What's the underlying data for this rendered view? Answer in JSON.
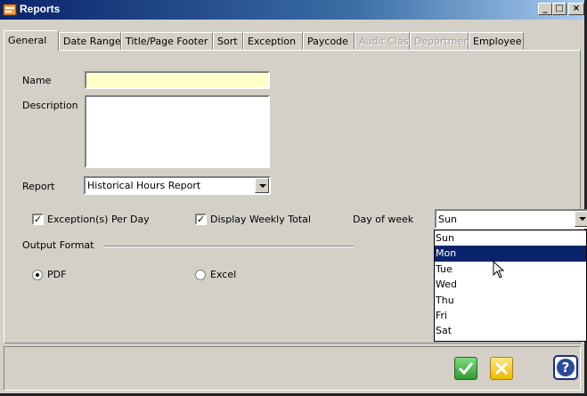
{
  "window": {
    "title": "Reports"
  },
  "tabs": [
    {
      "label": "General",
      "selected": true,
      "enabled": true
    },
    {
      "label": "Date Range",
      "enabled": true
    },
    {
      "label": "Title/Page Footer",
      "enabled": true
    },
    {
      "label": "Sort",
      "enabled": true
    },
    {
      "label": "Exception",
      "enabled": true
    },
    {
      "label": "Paycode",
      "enabled": true
    },
    {
      "label": "Audit Class",
      "enabled": false
    },
    {
      "label": "Department",
      "enabled": false
    },
    {
      "label": "Employee",
      "enabled": true
    }
  ],
  "form": {
    "name_label": "Name",
    "name_value": "",
    "description_label": "Description",
    "description_value": "",
    "report_label": "Report",
    "report_value": "Historical Hours Report",
    "exceptions_label": "Exception(s) Per Day",
    "exceptions_checked": true,
    "weekly_total_label": "Display Weekly Total",
    "weekly_total_checked": true,
    "day_of_week_label": "Day of week",
    "day_of_week_value": "Sun",
    "output_format_label": "Output Format",
    "pdf_label": "PDF",
    "excel_label": "Excel",
    "selected_format": "PDF"
  },
  "day_options": [
    "Sun",
    "Mon",
    "Tue",
    "Wed",
    "Thu",
    "Fri",
    "Sat"
  ],
  "highlighted_day": "Mon",
  "colors": {
    "title_bar": "#0a246a",
    "highlight": "#0a246a",
    "name_field": "#ffffc8",
    "ok": "#3fae3f",
    "cancel": "#f5c400",
    "help": "#2a4a9a"
  },
  "icons": {
    "title": "reports-app-icon",
    "ok": "checkmark-icon",
    "cancel": "cancel-x-icon",
    "help": "question-mark-icon"
  }
}
